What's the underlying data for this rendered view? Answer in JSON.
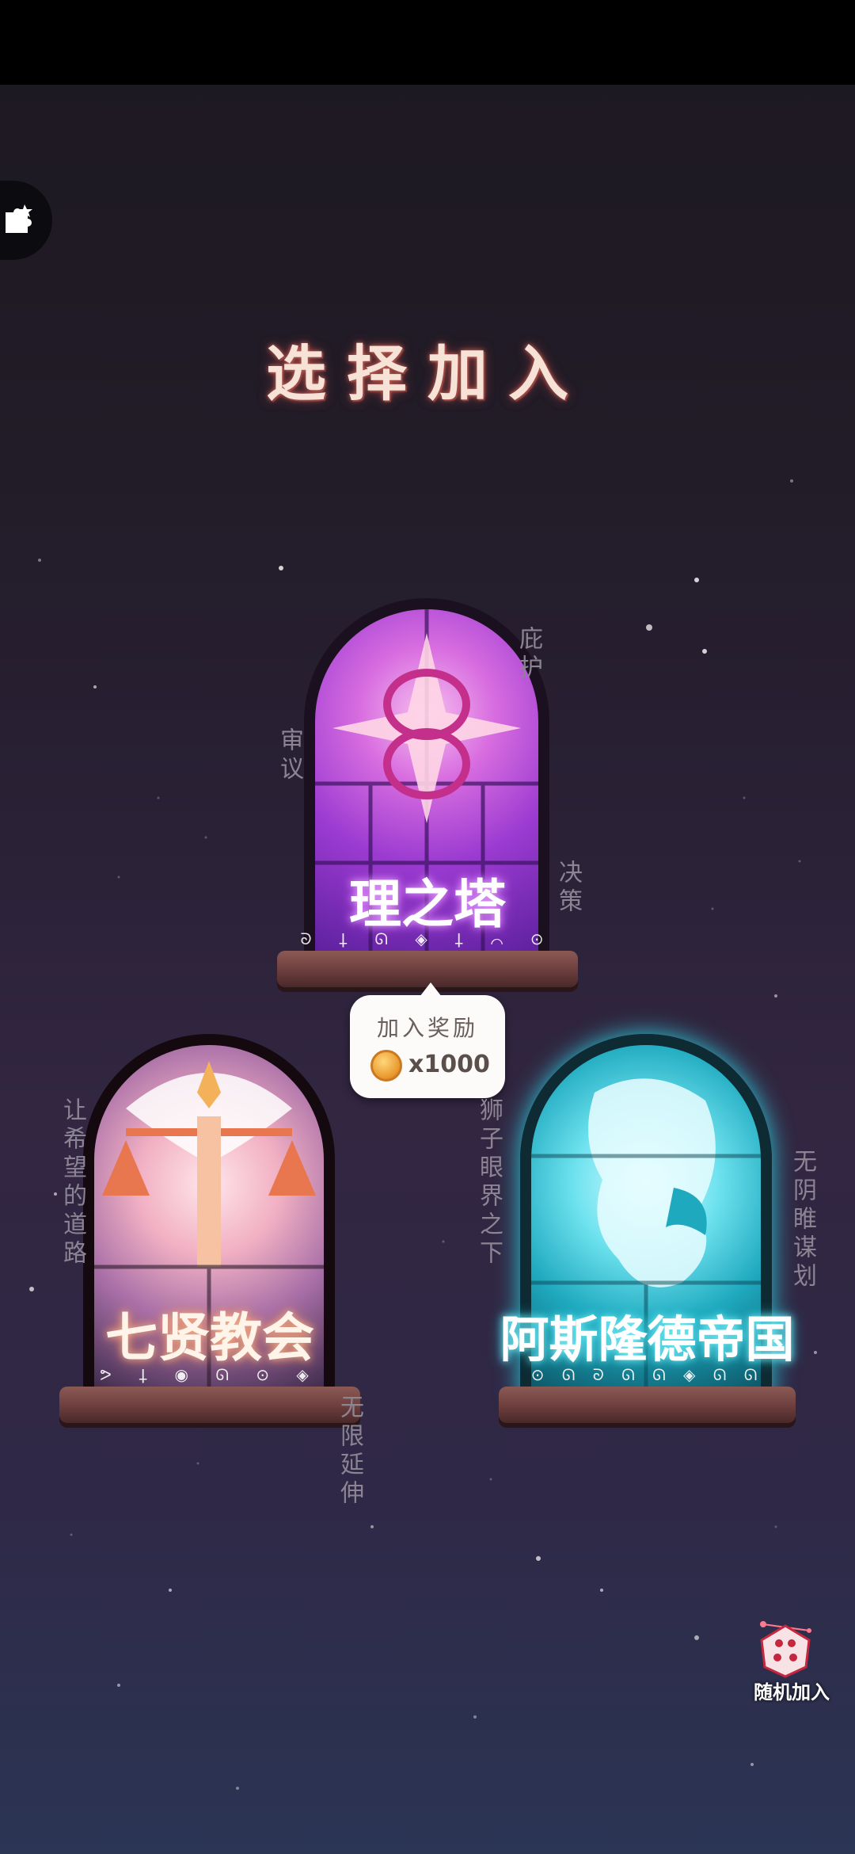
{
  "title": "选择加入",
  "factions": [
    {
      "name": "理之塔",
      "runes": "ᘐ ⸸ ᘏ ◈ ⸸ ⌒ ⊙",
      "tags": [
        "庇护",
        "审议",
        "决策"
      ],
      "color": "#b54ee0"
    },
    {
      "name": "七贤教会",
      "runes": "ᕗ ⸸ ◉ ᘏ ⊙ ◈",
      "tags": [
        "让希望的道路",
        "无限延伸"
      ],
      "color": "#f0a06a"
    },
    {
      "name": "阿斯隆德帝国",
      "runes": "⊙ ᘏ ᘐ ᘏ ᘏ ◈ ᘏ ᘏ",
      "tags": [
        "狮子眼界之下",
        "无阴睢谋划"
      ],
      "color": "#39d7e6"
    }
  ],
  "reward": {
    "label": "加入奖励",
    "amount": "x1000"
  },
  "random_join": {
    "label": "随机加入"
  },
  "icons": {
    "side_tab": "puzzle-icon",
    "coin": "coin-icon",
    "dice": "dice-icon"
  }
}
